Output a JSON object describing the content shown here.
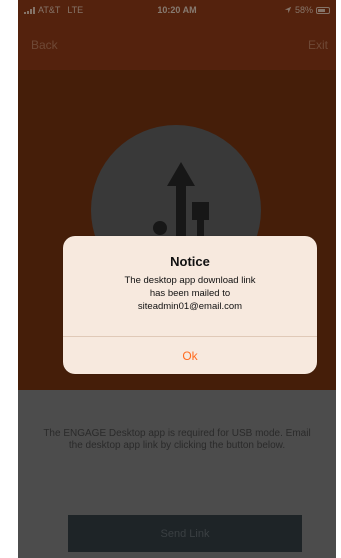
{
  "status_bar": {
    "carrier": "AT&T",
    "network": "LTE",
    "time": "10:20 AM",
    "battery": "58%"
  },
  "nav": {
    "back_label": "Back",
    "exit_label": "Exit"
  },
  "main": {
    "description": "The ENGAGE Desktop app is required for USB mode. Email the desktop app link by clicking the button below.",
    "send_button_label": "Send Link"
  },
  "alert": {
    "title": "Notice",
    "message_line1": "The desktop app download link",
    "message_line2": "has been mailed to",
    "message_line3": "siteadmin01@email.com",
    "ok_label": "Ok"
  },
  "icons": {
    "hero": "usb-icon",
    "signal": "signal-icon",
    "location": "location-arrow-icon",
    "battery": "battery-icon"
  },
  "colors": {
    "header": "#9a3f18",
    "accent": "#ff6b1f",
    "button": "#374248"
  }
}
